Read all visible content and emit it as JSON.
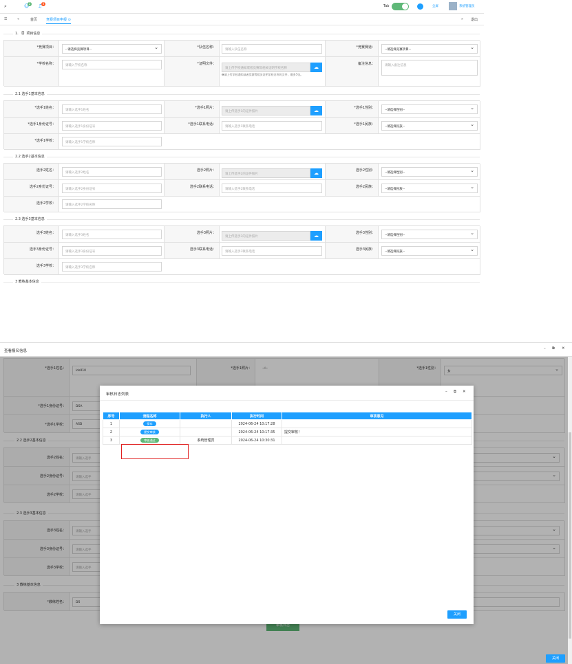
{
  "topbar": {
    "tab_label": "Tab",
    "fullscreen_label": "全屏",
    "user_name": "系统管理员",
    "badge1": "2",
    "badge2": "0"
  },
  "tabs": {
    "home": "首页",
    "current": "竞赛项目申报 ⊙",
    "exit": "退出"
  },
  "sections": {
    "s1": "1. 【】项目信息",
    "s21": "2.1 选手1基本信息",
    "s22": "2.2 选手2基本信息",
    "s23": "2.3 选手3基本信息",
    "s3": "3 教练基本信息"
  },
  "project": {
    "comp_label": "*竞赛项目：",
    "comp_value": "--请选择竞赛项目--",
    "team_label": "*队伍名称：",
    "team_placeholder": "请输入队伍名称",
    "track_label": "*竞赛赛道：",
    "track_value": "--请选择竞赛项目--",
    "school_label": "*学校名称：",
    "school_placeholder": "请输入学校名称",
    "proof_label": "*证明文件：",
    "proof_placeholder": "请上传学校通知或者竞赛等相关证明学校名称",
    "proof_hint": "❶请上传学校通知或者竞赛等相关证明学校名称的文件，最多5张。",
    "remark_label": "备注信息：",
    "remark_placeholder": "请输入备注信息"
  },
  "players": [
    {
      "name_label": "*选手1姓名：",
      "name_ph": "请输入选手1姓名",
      "photo_label": "*选手1照片：",
      "photo_ph": "请上传选手1的证件照片",
      "gender_label": "*选手1性别：",
      "gender_value": "--请选择性别--",
      "id_label": "*选手1身份证号：",
      "id_ph": "请输入选手1身份证号",
      "phone_label": "*选手1联系电话：",
      "phone_ph": "请输入选手1联系电话",
      "nation_label": "*选手1民族：",
      "nation_value": "--请选择民族--",
      "school_label": "*选手1学校：",
      "school_ph": "请输入选手1学校名称"
    },
    {
      "name_label": "选手2姓名：",
      "name_ph": "请输入选手2姓名",
      "photo_label": "选手2照片：",
      "photo_ph": "请上传选手2的证件照片",
      "gender_label": "选手2性别：",
      "gender_value": "--请选择性别--",
      "id_label": "选手2身份证号：",
      "id_ph": "请输入选手2身份证号",
      "phone_label": "选手2联系电话：",
      "phone_ph": "请输入选手2联系电话",
      "nation_label": "选手2民族：",
      "nation_value": "--请选择民族--",
      "school_label": "选手2学校：",
      "school_ph": "请输入选手2学校名称"
    },
    {
      "name_label": "选手3姓名：",
      "name_ph": "请输入选手3姓名",
      "photo_label": "选手3照片：",
      "photo_ph": "请上传选手3的证件照片",
      "gender_label": "选手3性别：",
      "gender_value": "--请选择性别--",
      "id_label": "选手3身份证号：",
      "id_ph": "请输入选手3身份证号",
      "phone_label": "选手3联系电话：",
      "phone_ph": "请输入选手3联系电话",
      "nation_label": "选手3民族：",
      "nation_value": "--请选择民族--",
      "school_label": "选手3学校：",
      "school_ph": "请输入选手3学校名称"
    }
  ],
  "view": {
    "title": "查看报名信息",
    "p1_name_label": "*选手1姓名：",
    "p1_name_value": "lds010",
    "p1_photo_label": "*选手1照片：",
    "p1_gender_label": "*选手1性别：",
    "p1_gender_value": "女",
    "p1_id_label": "*选手1身份证号：",
    "p1_id_value": "DSA",
    "p1_school_label": "*选手1学校：",
    "p1_school_value": "ASD",
    "s22": "2.2 选手2基本信息",
    "p2_name_label": "选手2姓名：",
    "p2_id_label": "选手2身份证号：",
    "p2_school_label": "选手2学校：",
    "s23": "2.3 选手3基本信息",
    "p3_name_label": "选手3姓名：",
    "p3_id_label": "选手3身份证号：",
    "p3_school_label": "选手3学校：",
    "input_ph_cut": "请输入选手",
    "s3": "3 教练基本信息",
    "coach_label": "*教练姓名：",
    "coach_value": "DS",
    "bottom_btn": "审核日志",
    "close": "关闭"
  },
  "log_dialog": {
    "title": "审核日志列表",
    "headers": [
      "序号",
      "流程名称",
      "执行人",
      "执行时间",
      "审核意见"
    ],
    "rows": [
      {
        "no": "1",
        "step": "保存",
        "step_color": "#1e9fff",
        "user": "",
        "time": "2024-06-24 10:17:28",
        "opinion": ""
      },
      {
        "no": "2",
        "step": "提交审核",
        "step_color": "#1e9fff",
        "user": "",
        "time": "2024-06-24 10:17:35",
        "opinion": "提交审核！"
      },
      {
        "no": "3",
        "step": "审核通过",
        "step_color": "#5fb878",
        "user": "系统管理员",
        "time": "2024-06-24 10:30:31",
        "opinion": ""
      }
    ],
    "close": "关闭"
  }
}
